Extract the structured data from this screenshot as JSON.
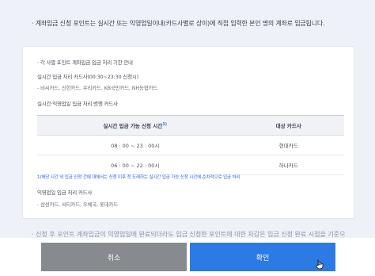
{
  "notice": {
    "top_text": "계좌입금 신청 포인트는 실시간 또는 익영업일이내(카드사별로 상이)에 직접 입력한 본인 명의 계좌로 입금됩니다.",
    "bottom_faded": "신청 후 포인트 계좌입금이 익영업일에 완료되더라도 입금 신청한 포인트에 대한 차감은 입금 신청 완료 시점을 기준으"
  },
  "deadline": {
    "title": "각 사별 포인트 계좌입금 입금 처리 기한 안내",
    "realtime_heading": "실시간 입금 처리 카드사(00:30~23:30 신청시)",
    "realtime_cards": "- 비씨카드, 신한카드, 우리카드, KB국민카드, NH농협카드",
    "mixed_heading": "실시간·익영업일 입금 처리 병행 카드사",
    "table": {
      "headers": [
        "실시간 입금 가능 신청 시간",
        "대상 카드사"
      ],
      "header_mark": "1)",
      "rows": [
        {
          "time": "08 : 00 ~ 23 : 00시",
          "card": "현대카드"
        },
        {
          "time": "06 : 00 ~ 22 : 00시",
          "card": "하나카드"
        }
      ]
    },
    "footnote": "1)해당 시간 외 입금 신청 건에 대해서는 신청 이후 첫 도래하는 실시간 입금 가능 신청 시간에 순차적으로 입금 처리",
    "next_day_heading": "익영업일 입금 처리 카드사",
    "next_day_cards": "- 삼성카드, 씨티카드, 우체국, 롯데카드"
  },
  "buttons": {
    "cancel": "취소",
    "confirm": "확인"
  },
  "colors": {
    "panel_bg": "#eef1f8",
    "cancel_bg": "#878a8f",
    "confirm_bg": "#2c7be5",
    "accent": "#2d6bd6"
  }
}
